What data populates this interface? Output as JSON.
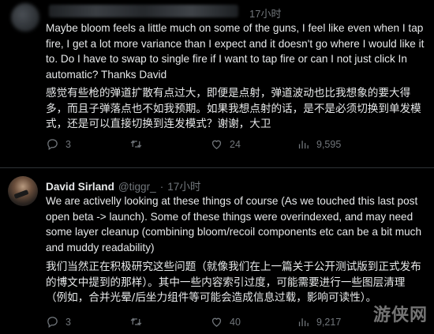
{
  "tweet1": {
    "time": "17小时",
    "text_en": "Maybe bloom feels a little much on some of the guns, I feel like even when I tap fire, I get a lot more variance than I expect and it doesn't go where I would like it to. Do I have to swap to single fire if I want to tap fire or can I not just click   In automatic? Thanks David",
    "text_cn": "感觉有些枪的弹道扩散有点过大，即便是点射，弹道波动也比我想象的要大得多，而且子弹落点也不如我预期。如果我想点射的话，是不是必须切换到单发模式，还是可以直接切换到连发模式？谢谢，大卫",
    "replies": "3",
    "reposts": "",
    "likes": "24",
    "views": "9,595"
  },
  "tweet2": {
    "author": "David Sirland",
    "handle": "@tiggr_",
    "separator": "·",
    "time": "17小时",
    "text_en": "We are activelly looking at these things of course (As we touched this last post open beta -> launch). Some of these things were overindexed, and may need some layer cleanup (combining bloom/recoil components etc can be a bit much and muddy readability)",
    "text_cn": "我们当然正在积极研究这些问题（就像我们在上一篇关于公开测试版到正式发布的博文中提到的那样）。其中一些内容索引过度，可能需要进行一些图层清理（例如，合并光晕/后坐力组件等可能会造成信息过载，影响可读性）。",
    "replies": "3",
    "reposts": "",
    "likes": "40",
    "views": "9,217"
  },
  "watermark": "游侠网",
  "icons": [
    "reply-icon",
    "repost-icon",
    "like-icon",
    "views-icon"
  ],
  "colors": {
    "background": "#000000",
    "text": "#e7e9ea",
    "muted": "#71767b"
  }
}
